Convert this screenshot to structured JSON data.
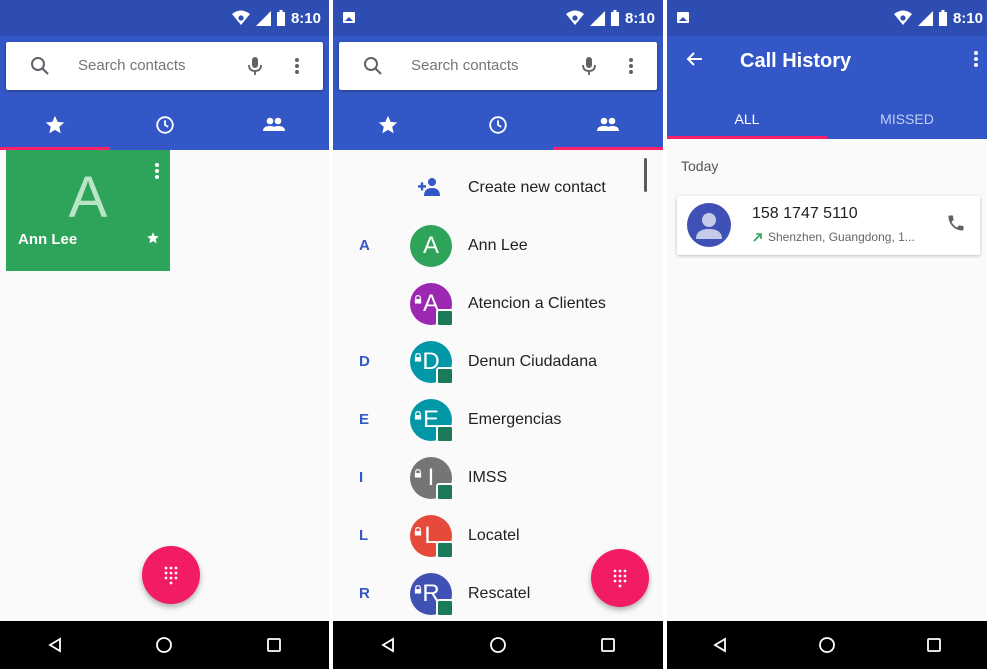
{
  "status_bar": {
    "time": "8:10"
  },
  "screen1": {
    "search": {
      "placeholder": "Search contacts"
    },
    "tabs": [
      {
        "icon": "star-icon",
        "active": true
      },
      {
        "icon": "clock-icon",
        "active": false
      },
      {
        "icon": "people-icon",
        "active": false
      }
    ],
    "favorite": {
      "initial": "A",
      "name": "Ann Lee",
      "color": "#2ea35a"
    }
  },
  "screen2": {
    "search": {
      "placeholder": "Search contacts"
    },
    "create_label": "Create new contact",
    "contacts": [
      {
        "section": "A",
        "initial": "A",
        "name": "Ann Lee",
        "color": "#2ea35a",
        "locked": false
      },
      {
        "section": "",
        "initial": "A",
        "name": "Atencion a Clientes",
        "color": "#9c27b0",
        "locked": true
      },
      {
        "section": "D",
        "initial": "D",
        "name": "Denun Ciudadana",
        "color": "#0097a7",
        "locked": true
      },
      {
        "section": "E",
        "initial": "E",
        "name": "Emergencias",
        "color": "#0097a7",
        "locked": true
      },
      {
        "section": "I",
        "initial": "I",
        "name": "IMSS",
        "color": "#757575",
        "locked": true
      },
      {
        "section": "L",
        "initial": "L",
        "name": "Locatel",
        "color": "#e64a3b",
        "locked": true
      },
      {
        "section": "R",
        "initial": "R",
        "name": "Rescatel",
        "color": "#3f51b5",
        "locked": true
      }
    ]
  },
  "screen3": {
    "title": "Call History",
    "tabs": {
      "all": "ALL",
      "missed": "MISSED"
    },
    "section": "Today",
    "call": {
      "number": "158 1747 5110",
      "location": "Shenzhen, Guangdong, 1..."
    }
  },
  "colors": {
    "accent": "#ff1f6b",
    "primary": "#3457c7",
    "primary_dark": "#2e4db3",
    "fab": "#f21c62"
  }
}
